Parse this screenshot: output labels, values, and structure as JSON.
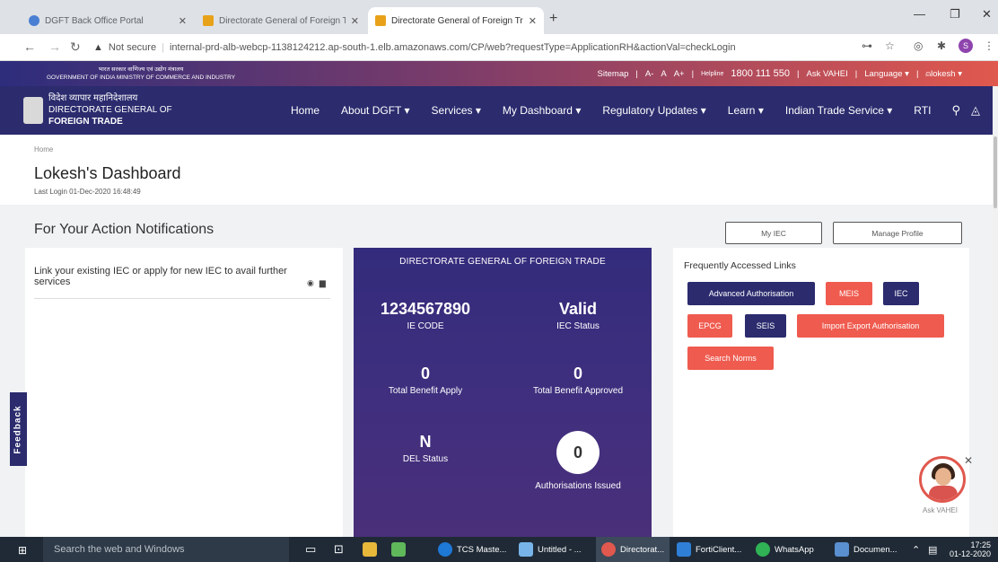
{
  "browser": {
    "tabs": [
      {
        "title": "DGFT Back Office Portal",
        "active": false,
        "icon_color": "#4a7fd4"
      },
      {
        "title": "Directorate General of Foreign Tr",
        "active": false,
        "icon_color": "#e8a21a"
      },
      {
        "title": "Directorate General of Foreign Tr",
        "active": true,
        "icon_color": "#e8a21a"
      }
    ],
    "security_label": "Not secure",
    "url": "internal-prd-alb-webcp-1138124212.ap-south-1.elb.amazonaws.com/CP/web?requestType=ApplicationRH&actionVal=checkLogin",
    "profile_initial": "S"
  },
  "utility_bar": {
    "gov_line1": "भारत सरकार वाणिज्य एवं उद्योग मंत्रालय",
    "gov_line2": "GOVERNMENT OF INDIA MINISTRY OF COMMERCE AND INDUSTRY",
    "sitemap": "Sitemap",
    "font_minus": "A-",
    "font_normal": "A",
    "font_plus": "A+",
    "helpline_label": "Helpline",
    "helpline_number": "1800 111 550",
    "ask_vahei": "Ask VAHEI",
    "language": "Language",
    "user": "lokesh"
  },
  "brand": {
    "hindi": "विदेश व्यापार महानिदेशालय",
    "line1": "DIRECTORATE GENERAL OF",
    "line2": "FOREIGN TRADE"
  },
  "nav": {
    "items": [
      "Home",
      "About DGFT",
      "Services",
      "My Dashboard",
      "Regulatory Updates",
      "Learn",
      "Indian Trade Service",
      "RTI"
    ]
  },
  "page": {
    "breadcrumb": "Home",
    "title": "Lokesh's Dashboard",
    "last_login": "Last Login 01-Dec-2020 16:48:49",
    "section_title": "For Your Action Notifications",
    "my_iec_button": "My IEC",
    "manage_profile_button": "Manage Profile"
  },
  "notification": {
    "text": "Link your existing IEC or apply for new IEC to avail further services"
  },
  "dgft_card": {
    "title": "DIRECTORATE GENERAL OF FOREIGN TRADE",
    "ie_code": "1234567890",
    "ie_code_label": "IE CODE",
    "iec_status": "Valid",
    "iec_status_label": "IEC Status",
    "total_benefit_apply": "0",
    "total_benefit_apply_label": "Total Benefit Apply",
    "total_benefit_approved": "0",
    "total_benefit_approved_label": "Total Benefit Approved",
    "del_status": "N",
    "del_status_label": "DEL Status",
    "authorisations_issued": "0",
    "authorisations_issued_label": "Authorisations Issued"
  },
  "links": {
    "title": "Frequently Accessed Links",
    "items": [
      "Advanced Authorisation",
      "MEIS",
      "IEC",
      "EPCG",
      "SEIS",
      "Import Export Authorisation",
      "Search Norms"
    ]
  },
  "feedback": "Feedback",
  "ask_vahei_widget": "Ask VAHEI",
  "taskbar": {
    "search_placeholder": "Search the web and Windows",
    "items": [
      "TCS Maste...",
      "Untitled - ...",
      "Directorat...",
      "FortiClient...",
      "WhatsApp",
      "Documen..."
    ],
    "time": "17:25",
    "date": "01-12-2020"
  },
  "colors": {
    "nav_bg": "#2b2b6e",
    "accent_red": "#ef5b4f",
    "card_purple": "#3f2f7e"
  }
}
